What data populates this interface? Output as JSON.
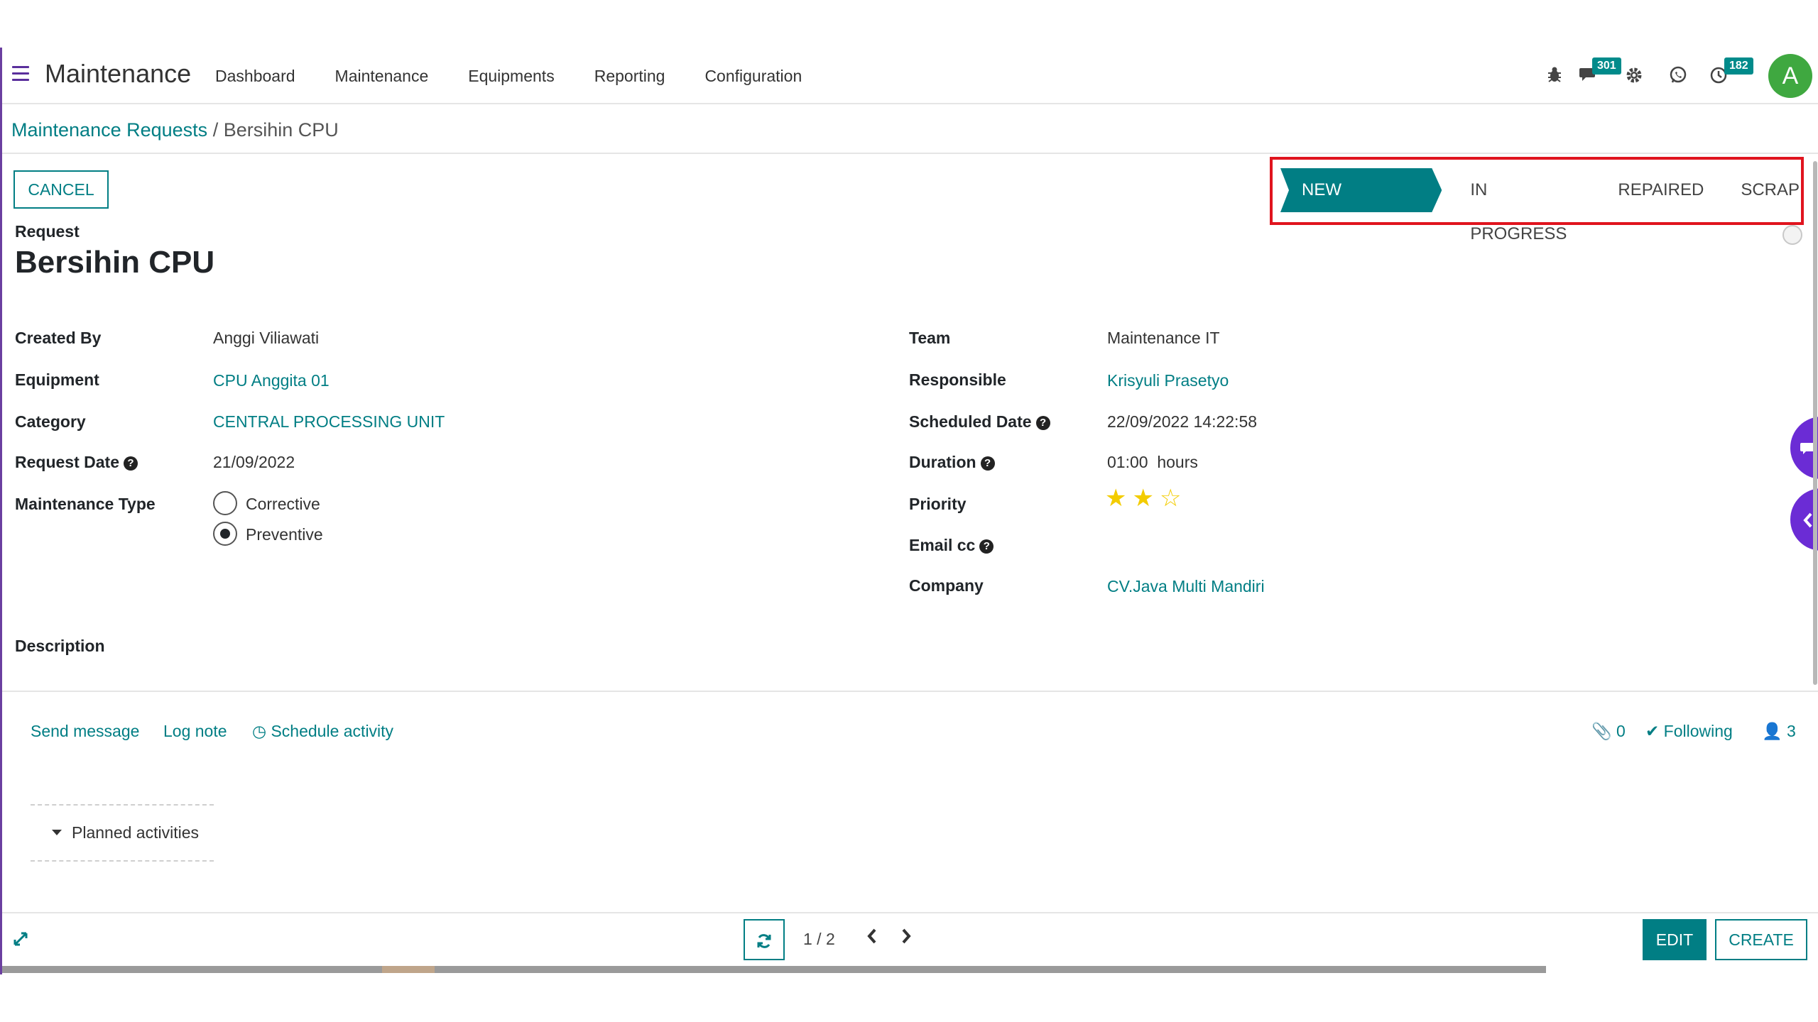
{
  "navbar": {
    "app_title": "Maintenance",
    "menu": [
      "Dashboard",
      "Maintenance",
      "Equipments",
      "Reporting",
      "Configuration"
    ],
    "icons": [
      "bug-icon",
      "chat-icon",
      "gear-icon",
      "whatsapp-icon",
      "clock-icon"
    ],
    "messages_count": "301",
    "activities_count": "182",
    "avatar_letter": "A"
  },
  "breadcrumb": {
    "parent": "Maintenance Requests",
    "separator": "/",
    "current": "Bersihin CPU"
  },
  "controls": {
    "cancel_label": "CANCEL"
  },
  "stages": [
    {
      "label": "NEW REQUEST",
      "active": true
    },
    {
      "label": "IN PROGRESS",
      "active": false
    },
    {
      "label": "REPAIRED",
      "active": false
    },
    {
      "label": "SCRAP",
      "active": false
    }
  ],
  "form": {
    "request_label": "Request",
    "title": "Bersihin CPU",
    "left": {
      "created_by_label": "Created By",
      "created_by": "Anggi Viliawati",
      "equipment_label": "Equipment",
      "equipment": "CPU Anggita 01",
      "category_label": "Category",
      "category": "CENTRAL PROCESSING UNIT",
      "request_date_label": "Request Date",
      "request_date": "21/09/2022",
      "maintenance_type_label": "Maintenance Type",
      "maintenance_type_options": [
        "Corrective",
        "Preventive"
      ],
      "maintenance_type_selected": "Preventive"
    },
    "right": {
      "team_label": "Team",
      "team": "Maintenance IT",
      "responsible_label": "Responsible",
      "responsible": "Krisyuli Prasetyo",
      "scheduled_date_label": "Scheduled Date",
      "scheduled_date": "22/09/2022 14:22:58",
      "duration_label": "Duration",
      "duration": "01:00",
      "duration_unit": "hours",
      "priority_label": "Priority",
      "priority_stars": 2,
      "priority_max": 3,
      "email_cc_label": "Email cc",
      "email_cc": "",
      "company_label": "Company",
      "company": "CV.Java Multi Mandiri"
    },
    "description_label": "Description"
  },
  "chatter": {
    "send_message": "Send message",
    "log_note": "Log note",
    "schedule_activity": "Schedule activity",
    "attachments_count": "0",
    "following": "Following",
    "followers_count": "3",
    "planned_activities": "Planned activities"
  },
  "pager": {
    "value": "1 / 2"
  },
  "buttons": {
    "edit": "EDIT",
    "create": "CREATE"
  },
  "colors": {
    "accent": "#017e84",
    "brand": "#6b3fa0",
    "highlight_box": "#e0141e",
    "star": "#f3cc00"
  }
}
